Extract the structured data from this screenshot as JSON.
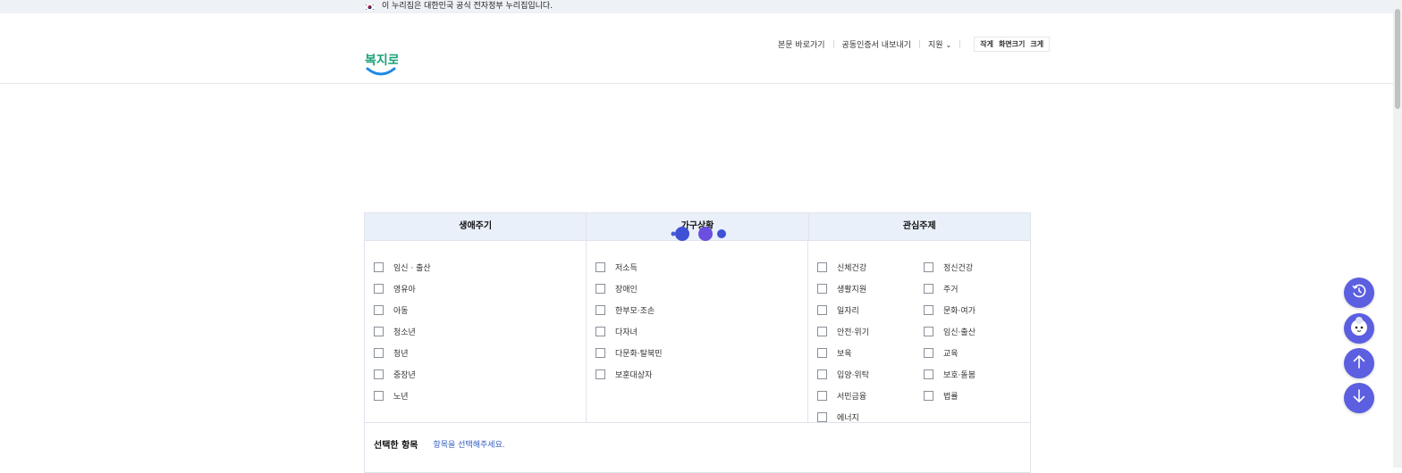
{
  "gov_banner": {
    "text": "이 누리집은 대한민국 공식 전자정부 누리집입니다."
  },
  "header": {
    "logo_text": "복지로",
    "utils": {
      "skip": "본문 바로가기",
      "cert": "공동인증서 내보내기",
      "region": "지원",
      "size_small": "작게",
      "size_label": "화면크기",
      "size_large": "크게"
    }
  },
  "filter": {
    "columns": [
      "생애주기",
      "가구상황",
      "관심주제"
    ],
    "life_cycle": [
      "임신 · 출산",
      "영유아",
      "아동",
      "청소년",
      "청년",
      "중장년",
      "노년"
    ],
    "household": [
      "저소득",
      "장애인",
      "한부모·조손",
      "다자녀",
      "다문화·탈북민",
      "보훈대상자"
    ],
    "interest_left": [
      "신체건강",
      "생활지원",
      "일자리",
      "안전·위기",
      "보육",
      "입양·위탁",
      "서민금융",
      "에너지"
    ],
    "interest_right": [
      "정신건강",
      "주거",
      "문화·여가",
      "임신·출산",
      "교육",
      "보호·돌봄",
      "법률"
    ],
    "selected_label": "선택한 항목",
    "selected_hint": "항목을 선택해주세요."
  },
  "colors": {
    "accent": "#5b5fe0",
    "header_bg": "#eaf0fa",
    "link": "#2f5bbf",
    "logo_green": "#1aa37a",
    "logo_blue": "#1e88e5"
  },
  "floating_buttons": [
    "history-icon",
    "chatbot-icon",
    "arrow-up-icon",
    "arrow-down-icon"
  ]
}
